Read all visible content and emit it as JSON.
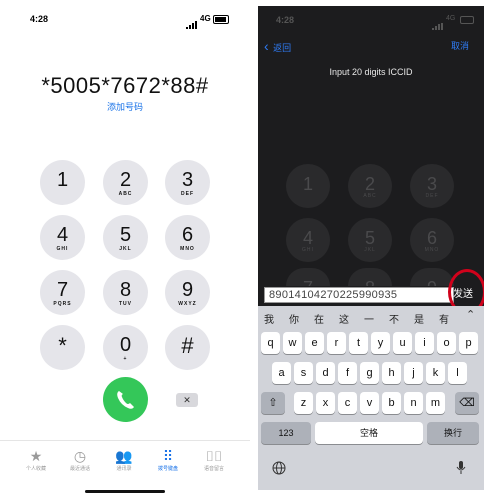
{
  "left": {
    "time": "4:28",
    "network": "4G",
    "dialed": "*5005*7672*88#",
    "add_number": "添加号码",
    "keys": [
      {
        "d": "1",
        "l": ""
      },
      {
        "d": "2",
        "l": "ABC"
      },
      {
        "d": "3",
        "l": "DEF"
      },
      {
        "d": "4",
        "l": "GHI"
      },
      {
        "d": "5",
        "l": "JKL"
      },
      {
        "d": "6",
        "l": "MNO"
      },
      {
        "d": "7",
        "l": "PQRS"
      },
      {
        "d": "8",
        "l": "TUV"
      },
      {
        "d": "9",
        "l": "WXYZ"
      },
      {
        "d": "*",
        "l": ""
      },
      {
        "d": "0",
        "l": "+"
      },
      {
        "d": "#",
        "l": ""
      }
    ],
    "tabs": [
      {
        "icon": "★",
        "label": "个人收藏"
      },
      {
        "icon": "◷",
        "label": "最近通话"
      },
      {
        "icon": "👥",
        "label": "通讯录"
      },
      {
        "icon": "⠿",
        "label": "拨号键盘"
      },
      {
        "icon": "⌷⌷",
        "label": "语音留言"
      }
    ]
  },
  "right": {
    "time": "4:28",
    "network": "4G",
    "back": "返回",
    "cancel": "取消",
    "title": "Input 20 digits ICCID",
    "keys": [
      {
        "d": "1",
        "l": ""
      },
      {
        "d": "2",
        "l": "ABC"
      },
      {
        "d": "3",
        "l": "DEF"
      },
      {
        "d": "4",
        "l": "GHI"
      },
      {
        "d": "5",
        "l": "JKL"
      },
      {
        "d": "6",
        "l": "MNO"
      },
      {
        "d": "7",
        "l": ""
      },
      {
        "d": "8",
        "l": ""
      },
      {
        "d": "9",
        "l": ""
      }
    ],
    "input_value": "89014104270225990935",
    "send": "发送",
    "candidates": [
      "我",
      "你",
      "在",
      "这",
      "一",
      "不",
      "是",
      "有"
    ],
    "row1": [
      "q",
      "w",
      "e",
      "r",
      "t",
      "y",
      "u",
      "i",
      "o",
      "p"
    ],
    "row2": [
      "a",
      "s",
      "d",
      "f",
      "g",
      "h",
      "j",
      "k",
      "l"
    ],
    "row3": [
      "z",
      "x",
      "c",
      "v",
      "b",
      "n",
      "m"
    ],
    "num_key": "123",
    "space_key": "空格",
    "return_key": "换行"
  }
}
